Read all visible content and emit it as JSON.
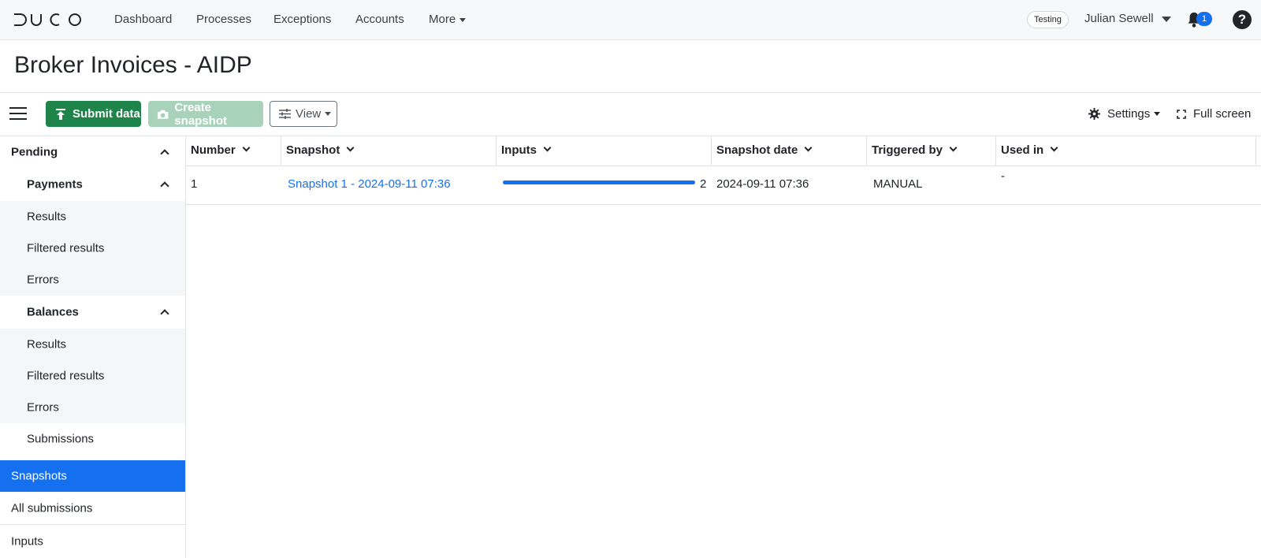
{
  "app": {
    "logo_text": "DUCO",
    "env_badge": "Testing",
    "user_name": "Julian Sewell",
    "notifications_count": "1",
    "help": "?"
  },
  "nav": {
    "items": [
      "Dashboard",
      "Processes",
      "Exceptions",
      "Accounts"
    ],
    "more": "More"
  },
  "page": {
    "title": "Broker Invoices - AIDP"
  },
  "toolbar": {
    "submit_label": "Submit data",
    "snapshot_label": "Create snapshot",
    "view_label": "View",
    "settings_label": "Settings",
    "fullscreen_label": "Full screen"
  },
  "sidebar": {
    "pending": "Pending",
    "payments": {
      "label": "Payments",
      "items": [
        "Results",
        "Filtered results",
        "Errors"
      ]
    },
    "balances": {
      "label": "Balances",
      "items": [
        "Results",
        "Filtered results",
        "Errors"
      ]
    },
    "submissions": "Submissions",
    "snapshots": "Snapshots",
    "all_submissions": "All submissions",
    "inputs": "Inputs"
  },
  "table": {
    "columns": [
      "Number",
      "Snapshot",
      "Inputs",
      "Snapshot date",
      "Triggered by",
      "Used in"
    ],
    "rows": [
      {
        "number": "1",
        "snapshot": "Snapshot 1 - 2024-09-11 07:36",
        "inputs_count": "2",
        "inputs_progress": 1.0,
        "snapshot_date": "2024-09-11 07:36",
        "triggered_by": "MANUAL",
        "used_in": "-"
      }
    ]
  },
  "colors": {
    "primary": "#1570ef",
    "success": "#1e8449",
    "success_disabled": "#a8d2b9"
  },
  "icons": [
    "bell-icon",
    "help-icon",
    "hamburger-icon",
    "upload-icon",
    "camera-icon",
    "sliders-icon",
    "gear-icon",
    "expand-icon",
    "chevron-up-icon",
    "chevron-down-icon"
  ]
}
